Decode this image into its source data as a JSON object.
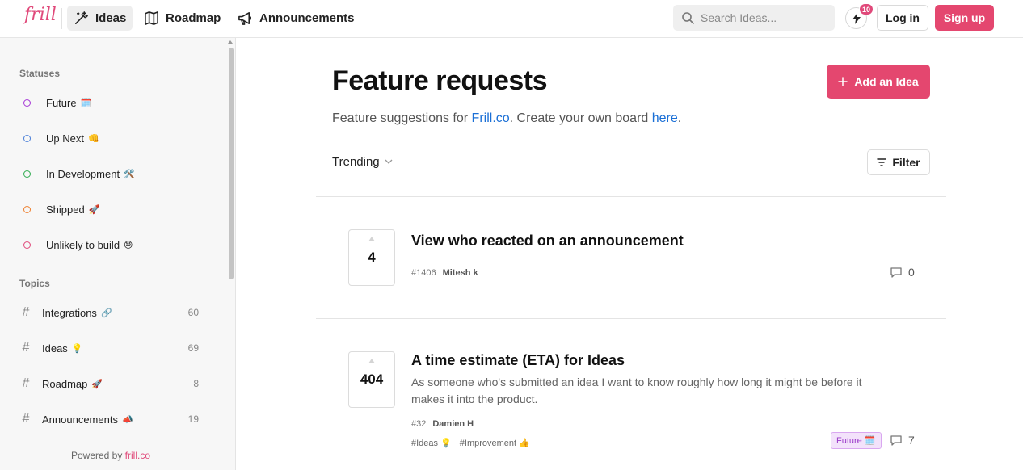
{
  "header": {
    "logo": "frill",
    "nav": [
      {
        "label": "Ideas",
        "icon": "magic-wand-icon"
      },
      {
        "label": "Roadmap",
        "icon": "map-icon"
      },
      {
        "label": "Announcements",
        "icon": "megaphone-icon"
      }
    ],
    "search_placeholder": "Search Ideas...",
    "notification_count": "10",
    "login_label": "Log in",
    "signup_label": "Sign up"
  },
  "sidebar": {
    "statuses_heading": "Statuses",
    "statuses": [
      {
        "label": "Future",
        "emoji": "🗓️",
        "color": "#a537d6"
      },
      {
        "label": "Up Next",
        "emoji": "👊",
        "color": "#4a7fd8"
      },
      {
        "label": "In Development",
        "emoji": "🛠️",
        "color": "#2eab4f"
      },
      {
        "label": "Shipped",
        "emoji": "🚀",
        "color": "#ee7f2d"
      },
      {
        "label": "Unlikely to build",
        "emoji": "😓",
        "color": "#e0497a"
      }
    ],
    "topics_heading": "Topics",
    "topics": [
      {
        "label": "Integrations",
        "emoji": "🔗",
        "count": "60"
      },
      {
        "label": "Ideas",
        "emoji": "💡",
        "count": "69"
      },
      {
        "label": "Roadmap",
        "emoji": "🚀",
        "count": "8"
      },
      {
        "label": "Announcements",
        "emoji": "📣",
        "count": "19"
      }
    ],
    "powered_prefix": "Powered by ",
    "powered_link": "frill.co"
  },
  "main": {
    "title": "Feature requests",
    "add_label": "Add an Idea",
    "subtitle_prefix": "Feature suggestions for ",
    "subtitle_link1": "Frill.co",
    "subtitle_middle": ". Create your own board ",
    "subtitle_link2": "here",
    "subtitle_suffix": ".",
    "sort_label": "Trending",
    "filter_label": "Filter",
    "ideas": [
      {
        "votes": "4",
        "title": "View who reacted on an announcement",
        "description": "",
        "id": "#1406",
        "author": "Mitesh k",
        "comments": "0",
        "tags": [],
        "status": ""
      },
      {
        "votes": "404",
        "title": "A time estimate (ETA) for Ideas",
        "description": "As someone who's submitted an idea I want to know roughly how long it might be before it makes it into the product.",
        "id": "#32",
        "author": "Damien H",
        "comments": "7",
        "tags": [
          "#Ideas 💡",
          "#Improvement 👍"
        ],
        "status": "Future 🗓️"
      }
    ]
  },
  "colors": {
    "brand": "#e4476f",
    "link": "#1a6fd6"
  }
}
